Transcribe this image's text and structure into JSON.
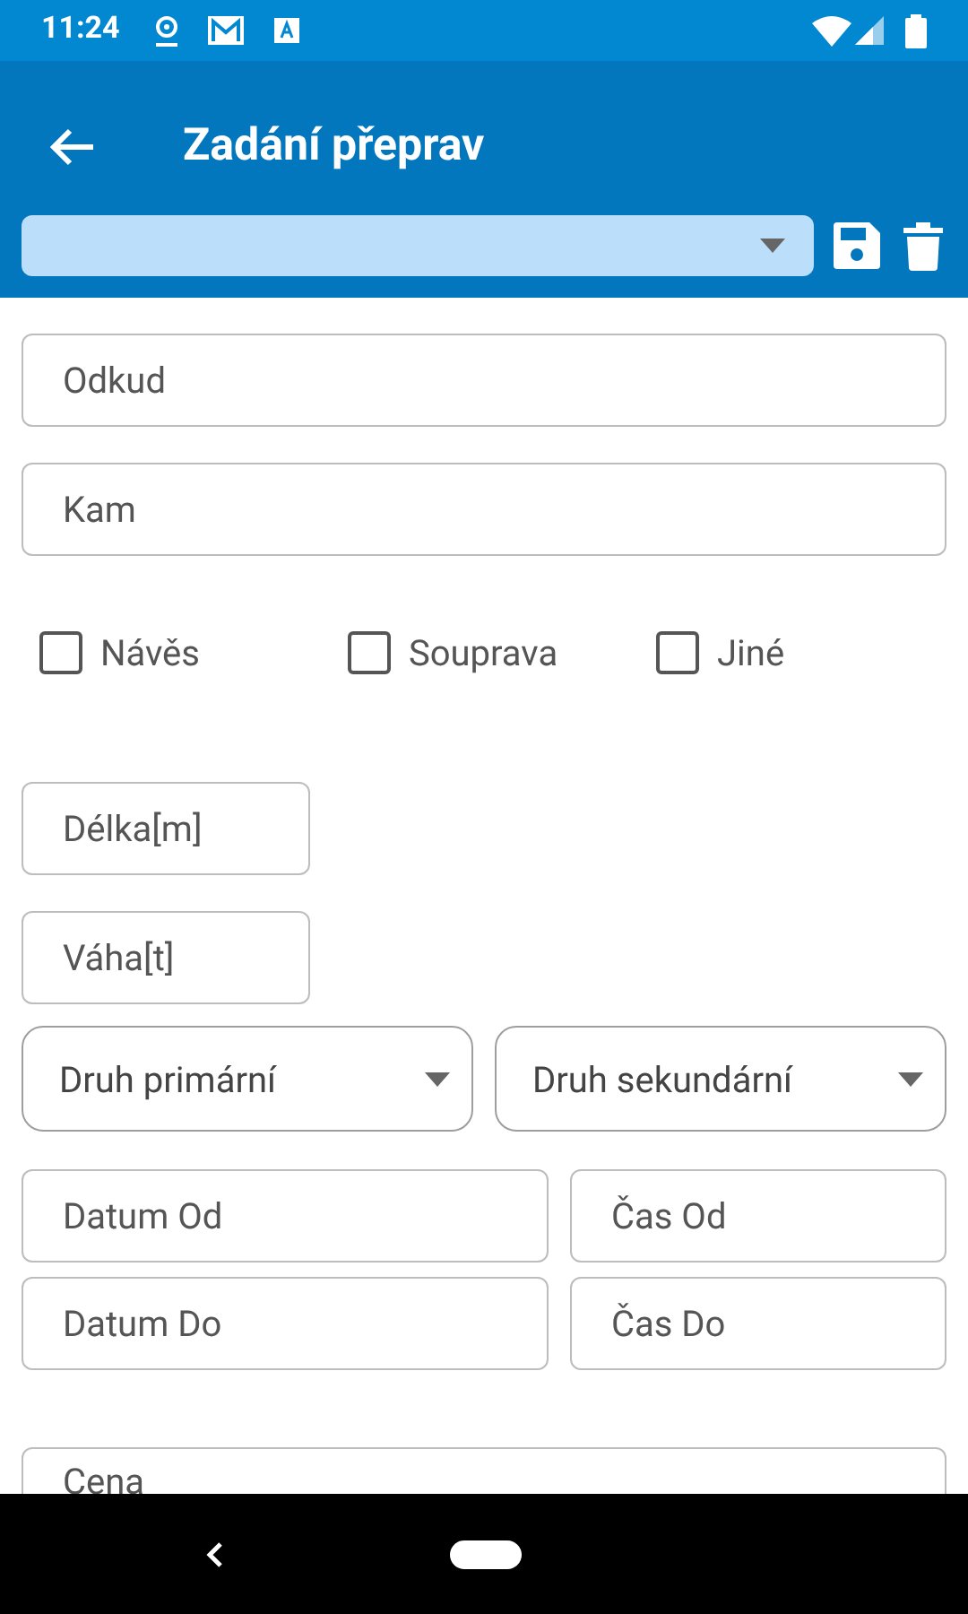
{
  "status_bar": {
    "time": "11:24"
  },
  "app_bar": {
    "title": "Zadání přeprav"
  },
  "fields_top": [
    {
      "placeholder": "Odkud"
    },
    {
      "placeholder": "Kam"
    }
  ],
  "checkboxes": [
    {
      "label": "Návěs",
      "checked": false
    },
    {
      "label": "Souprava",
      "checked": false
    },
    {
      "label": "Jiné",
      "checked": false
    }
  ],
  "fields_small": [
    {
      "placeholder": "Délka[m]"
    },
    {
      "placeholder": "Váha[t]"
    }
  ],
  "selects": [
    {
      "label": "Druh primární"
    },
    {
      "label": "Druh sekundární"
    }
  ],
  "date_rows": [
    {
      "date": {
        "placeholder": "Datum Od"
      },
      "time": {
        "placeholder": "Čas Od"
      }
    },
    {
      "date": {
        "placeholder": "Datum Do"
      },
      "time": {
        "placeholder": "Čas Do"
      }
    }
  ],
  "price": {
    "placeholder": "Cena"
  }
}
